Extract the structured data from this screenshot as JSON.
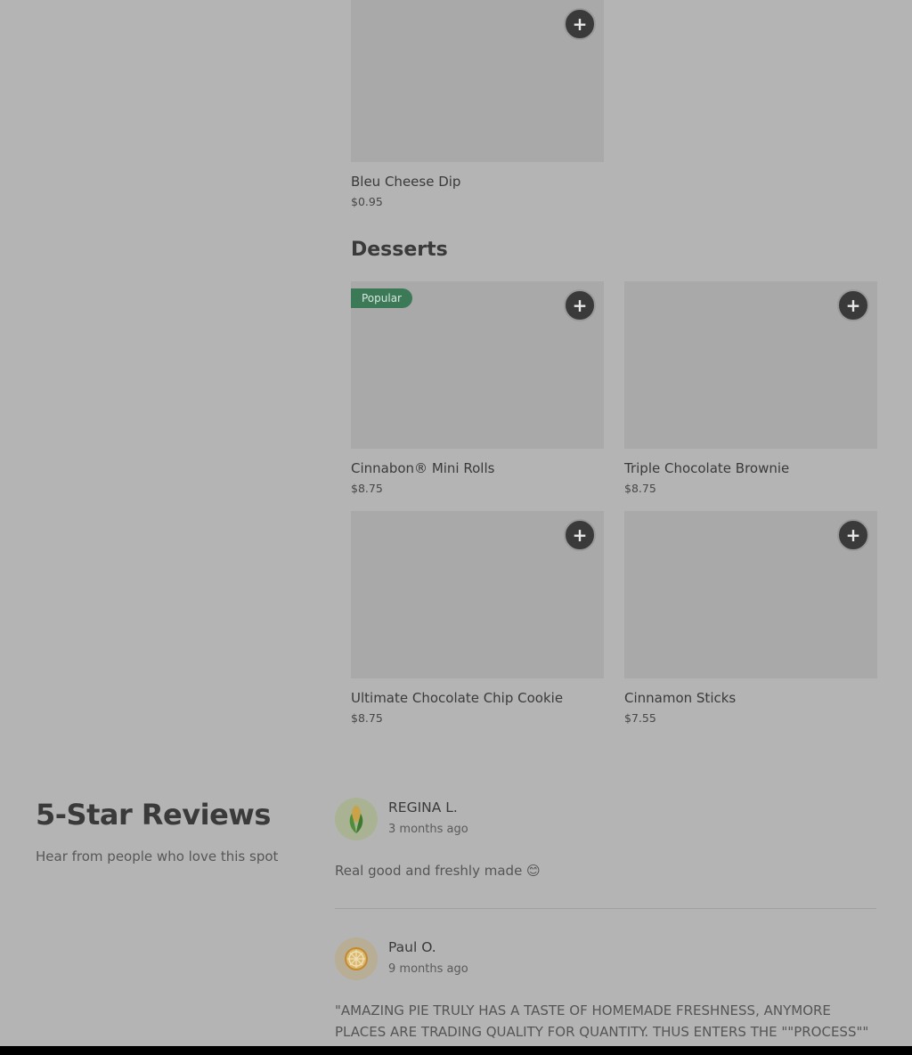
{
  "add_symbol": "+",
  "menu_top": {
    "items": [
      {
        "name": "Bleu Cheese Dip",
        "price": "$0.95"
      }
    ]
  },
  "desserts": {
    "title": "Desserts",
    "items": [
      {
        "name": "Cinnabon® Mini Rolls",
        "price": "$8.75",
        "badge": "Popular"
      },
      {
        "name": "Triple Chocolate Brownie",
        "price": "$8.75"
      },
      {
        "name": "Ultimate Chocolate Chip Cookie",
        "price": "$8.75"
      },
      {
        "name": "Cinnamon Sticks",
        "price": "$7.55"
      }
    ]
  },
  "reviews": {
    "title": "5-Star Reviews",
    "subtitle": "Hear from people who love this spot",
    "items": [
      {
        "reviewer": "REGINA L.",
        "time": "3 months ago",
        "text": "Real good and freshly made 😊",
        "avatar_icon": "corn-icon"
      },
      {
        "reviewer": "Paul O.",
        "time": "9 months ago",
        "text": "\"AMAZING PIE TRULY HAS A TASTE OF HOMEMADE FRESHNESS, ANYMORE PLACES ARE TRADING QUALITY FOR QUANTITY. THUS ENTERS THE \"\"PROCESS\"\"",
        "avatar_icon": "citrus-icon"
      }
    ]
  },
  "colors": {
    "background": "#b4b4b4",
    "card_image": "#a9a9a9",
    "add_button": "#3a3a3a",
    "popular_badge": "#3c7a57"
  }
}
